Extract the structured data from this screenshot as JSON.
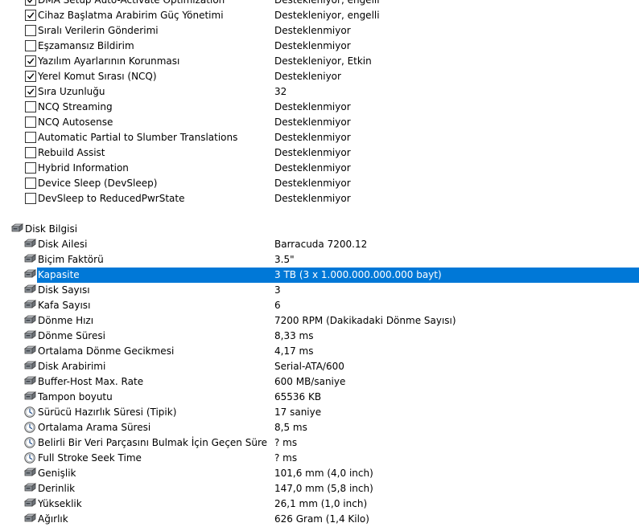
{
  "features": [
    {
      "label": "DMA Setup Auto-Activate Optimization",
      "value": "Destekleniyor, engelli",
      "checked": true
    },
    {
      "label": "Cihaz Başlatma Arabirim Güç Yönetimi",
      "value": "Destekleniyor, engelli",
      "checked": true
    },
    {
      "label": "Sıralı Verilerin Gönderimi",
      "value": "Desteklenmiyor",
      "checked": false
    },
    {
      "label": "Eşzamansız Bildirim",
      "value": "Desteklenmiyor",
      "checked": false
    },
    {
      "label": "Yazılım Ayarlarının Korunması",
      "value": "Destekleniyor, Etkin",
      "checked": true
    },
    {
      "label": "Yerel Komut Sırası (NCQ)",
      "value": "Destekleniyor",
      "checked": true
    },
    {
      "label": "Sıra Uzunluğu",
      "value": "32",
      "checked": true
    },
    {
      "label": "NCQ Streaming",
      "value": "Desteklenmiyor",
      "checked": false
    },
    {
      "label": "NCQ Autosense",
      "value": "Desteklenmiyor",
      "checked": false
    },
    {
      "label": "Automatic Partial to Slumber Translations",
      "value": "Desteklenmiyor",
      "checked": false
    },
    {
      "label": "Rebuild Assist",
      "value": "Desteklenmiyor",
      "checked": false
    },
    {
      "label": "Hybrid Information",
      "value": "Desteklenmiyor",
      "checked": false
    },
    {
      "label": "Device Sleep (DevSleep)",
      "value": "Desteklenmiyor",
      "checked": false
    },
    {
      "label": "DevSleep to ReducedPwrState",
      "value": "Desteklenmiyor",
      "checked": false
    }
  ],
  "section": {
    "title": "Disk Bilgisi",
    "icon": "hard-drive-icon"
  },
  "disk": [
    {
      "label": "Disk Ailesi",
      "value": "Barracuda 7200.12",
      "icon": "hard-drive-icon"
    },
    {
      "label": "Biçim Faktörü",
      "value": "3.5\"",
      "icon": "hard-drive-icon"
    },
    {
      "label": "Kapasite",
      "value": "3 TB (3 x 1.000.000.000.000 bayt)",
      "icon": "hard-drive-icon",
      "selected": true
    },
    {
      "label": "Disk Sayısı",
      "value": "3",
      "icon": "hard-drive-icon"
    },
    {
      "label": "Kafa Sayısı",
      "value": "6",
      "icon": "hard-drive-icon"
    },
    {
      "label": "Dönme Hızı",
      "value": "7200 RPM (Dakikadaki Dönme Sayısı)",
      "icon": "hard-drive-icon"
    },
    {
      "label": "Dönme Süresi",
      "value": "8,33 ms",
      "icon": "hard-drive-icon"
    },
    {
      "label": "Ortalama Dönme Gecikmesi",
      "value": "4,17 ms",
      "icon": "hard-drive-icon"
    },
    {
      "label": "Disk Arabirimi",
      "value": "Serial-ATA/600",
      "icon": "hard-drive-icon"
    },
    {
      "label": "Buffer-Host Max. Rate",
      "value": "600 MB/saniye",
      "icon": "hard-drive-icon"
    },
    {
      "label": "Tampon boyutu",
      "value": "65536 KB",
      "icon": "hard-drive-icon"
    },
    {
      "label": "Sürücü Hazırlık Süresi (Tipik)",
      "value": "17 saniye",
      "icon": "clock-icon"
    },
    {
      "label": "Ortalama Arama Süresi",
      "value": "8,5 ms",
      "icon": "clock-icon"
    },
    {
      "label": "Belirli Bir Veri Parçasını Bulmak İçin Geçen Süre",
      "value": "? ms",
      "icon": "clock-icon"
    },
    {
      "label": "Full Stroke Seek Time",
      "value": "? ms",
      "icon": "clock-icon"
    },
    {
      "label": "Genişlik",
      "value": "101,6 mm (4,0 inch)",
      "icon": "hard-drive-icon"
    },
    {
      "label": "Derinlik",
      "value": "147,0 mm (5,8 inch)",
      "icon": "hard-drive-icon"
    },
    {
      "label": "Yükseklik",
      "value": "26,1 mm (1,0 inch)",
      "icon": "hard-drive-icon"
    },
    {
      "label": "Ağırlık",
      "value": "626 Gram (1,4 Kilo)",
      "icon": "hard-drive-icon"
    }
  ],
  "colors": {
    "selection": "#0078d7",
    "selection_text": "#ffffff"
  }
}
